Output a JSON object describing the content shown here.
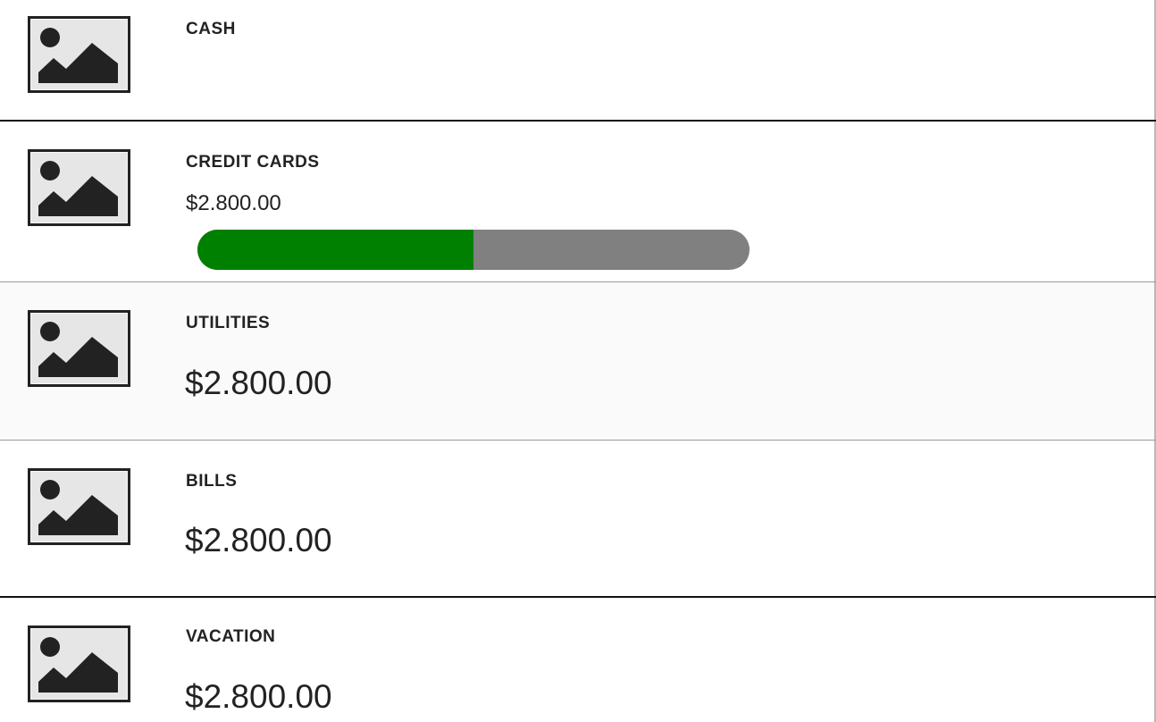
{
  "accounts": [
    {
      "title": "CASH",
      "amount": ""
    },
    {
      "title": "CREDIT CARDS",
      "amount": "$2.800.00",
      "progress": 0.5
    },
    {
      "title": "UTILITIES",
      "amount": "$2.800.00"
    },
    {
      "title": "BILLS",
      "amount": "$2.800.00"
    },
    {
      "title": "VACATION",
      "amount": "$2.800.00"
    }
  ],
  "icons": {
    "thumbnail": "image-placeholder-icon"
  },
  "colors": {
    "progress_fill": "#008000",
    "progress_track": "#808080",
    "text": "#222222"
  }
}
